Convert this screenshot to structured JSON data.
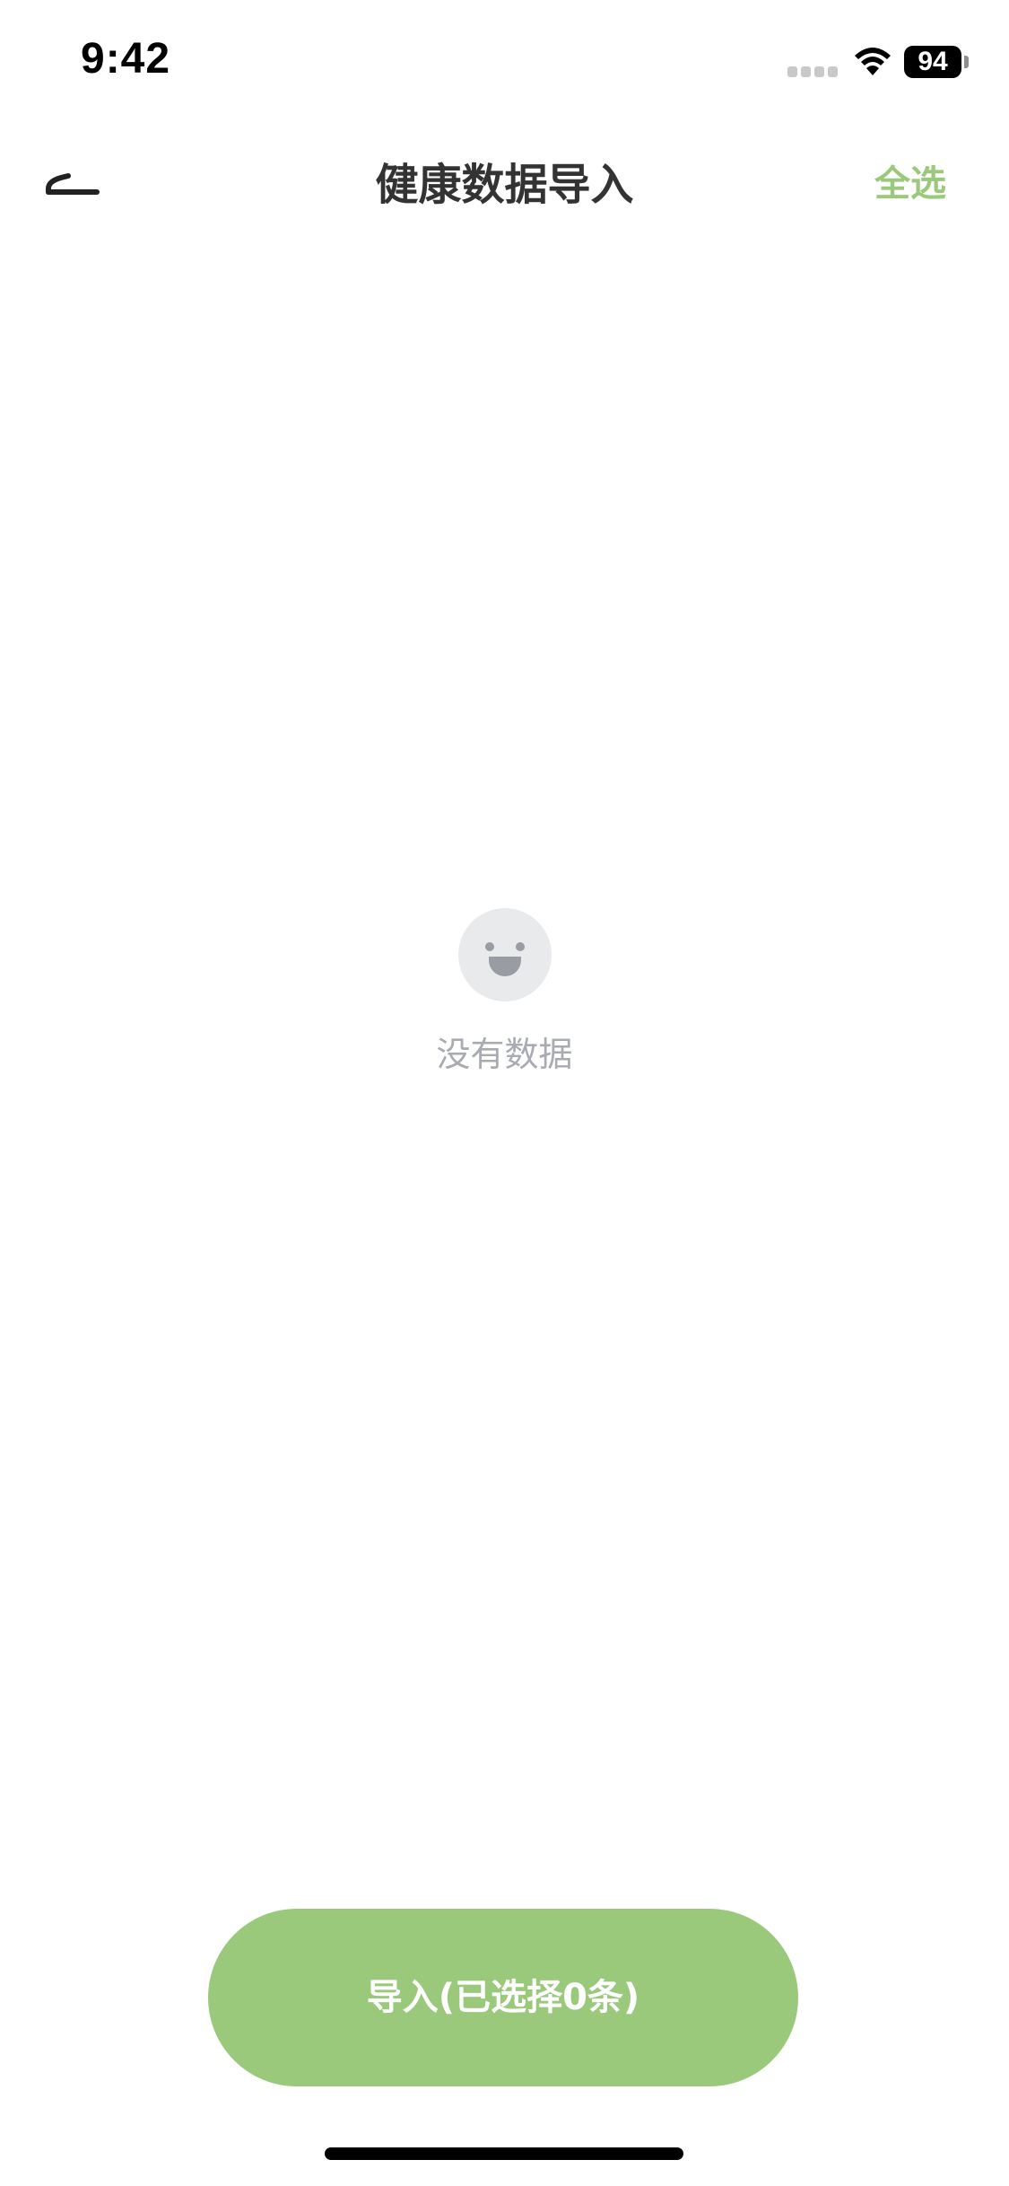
{
  "status_bar": {
    "time": "9:42",
    "battery": "94"
  },
  "nav": {
    "title": "健康数据导入",
    "select_all": "全选"
  },
  "empty_state": {
    "message": "没有数据"
  },
  "footer": {
    "import_label": "导入(已选择0条)"
  },
  "colors": {
    "accent": "#9bc97c",
    "title": "#333333",
    "muted": "#a9abb2"
  },
  "icons": {
    "back": "back-arrow-icon",
    "empty": "smiley-face-icon",
    "wifi": "wifi-icon",
    "battery": "battery-icon",
    "signal": "cellular-signal-icon"
  }
}
